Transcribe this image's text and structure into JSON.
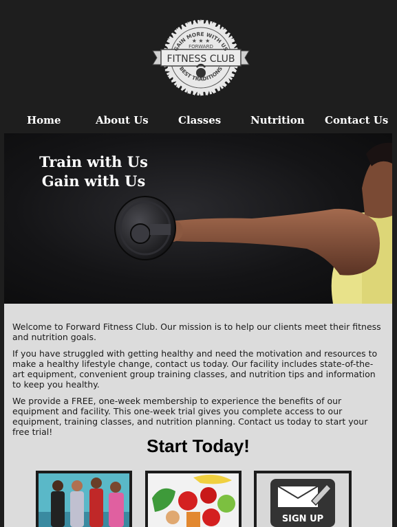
{
  "logo": {
    "arc_top": "GAIN MORE WITH US",
    "subtitle": "FORWARD",
    "name": "FITNESS CLUB",
    "arc_bottom": "BEST TRADITIONS"
  },
  "nav": {
    "items": [
      {
        "label": "Home"
      },
      {
        "label": "About Us"
      },
      {
        "label": "Classes"
      },
      {
        "label": "Nutrition"
      },
      {
        "label": "Contact Us"
      }
    ]
  },
  "hero": {
    "line1": "Train with Us",
    "line2": "Gain with Us"
  },
  "content": {
    "p1": "Welcome to Forward Fitness Club. Our mission is to help our clients meet their fitness and nutrition goals.",
    "p2": "If you have struggled with getting healthy and need the motivation and resources to make a healthy lifestyle change, contact us today. Our facility includes state-of-the-art equipment, convenient group training classes, and nutrition tips and information to keep you healthy.",
    "p3": "We provide a FREE, one-week membership to experience the benefits of our equipment and facility. This one-week trial gives you complete access to our equipment, training classes, and nutrition planning. Contact us today to start your free trial!",
    "start_heading": "Start Today!"
  },
  "thumbs": {
    "signup_label": "SIGN UP"
  },
  "colors": {
    "background": "#1e1e1e",
    "content_bg": "#dcdcdc",
    "nav_text": "#ffffff"
  }
}
